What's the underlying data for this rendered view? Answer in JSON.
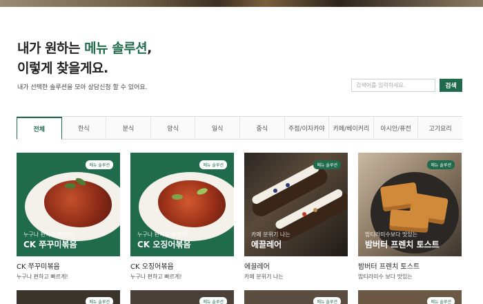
{
  "hero": {
    "image": "food-photo-strip"
  },
  "header": {
    "line1_prefix": "내가 원하는 ",
    "line1_accent": "메뉴 솔루션",
    "line1_suffix": ",",
    "line2": "이렇게 찾을게요.",
    "subtext": "내가 선택한 솔루션을 모아 상담신청 할 수 있어요."
  },
  "search": {
    "placeholder": "검색어를 입력하세요.",
    "button_label": "검색"
  },
  "tabs": [
    {
      "label": "전체",
      "active": true
    },
    {
      "label": "한식"
    },
    {
      "label": "분식"
    },
    {
      "label": "양식"
    },
    {
      "label": "일식"
    },
    {
      "label": "중식"
    },
    {
      "label": "주점/이자카야"
    },
    {
      "label": "카페/베이커리"
    },
    {
      "label": "아시안/퓨전"
    },
    {
      "label": "고기요리"
    }
  ],
  "cards": [
    {
      "badge": "메뉴 솔루션",
      "overlay_sub": "누구나 편하고 빠르게!",
      "overlay_title": "CK 쭈꾸미볶음",
      "title": "CK 쭈꾸미볶음",
      "desc": "누구나 편하고 빠르게!"
    },
    {
      "badge": "메뉴 솔루션",
      "overlay_sub": "누구나 편하고 빠르게!",
      "overlay_title": "CK 오징어볶음",
      "title": "CK 오징어볶음",
      "desc": "누구나 편하고 빠르게!"
    },
    {
      "badge": "메뉴 솔루션",
      "overlay_sub": "카페 분위기 나는",
      "overlay_title": "에끌레어",
      "title": "에끌레어",
      "desc": "카페 분위기 나는"
    },
    {
      "badge": "메뉴 솔루션",
      "overlay_sub": "밥티라미수보다 맛있는",
      "overlay_title": "밤버터 프렌치 토스트",
      "title": "밤버터 프렌치 토스트",
      "desc": "밥티라미수 보다 맛있는"
    }
  ],
  "row2_badges": [
    "메뉴 솔루션",
    "메뉴 솔루션",
    "메뉴 솔루션",
    "메뉴 솔루션"
  ],
  "colors": {
    "accent": "#1f6b4c"
  }
}
